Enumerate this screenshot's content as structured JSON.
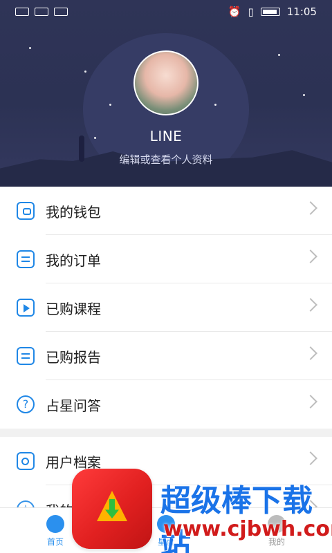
{
  "status_bar": {
    "time": "11:05",
    "left_icons": [
      "sim-icon",
      "signal-icon",
      "wifi-icon"
    ],
    "right_icons": [
      "alarm-icon",
      "vibrate-icon",
      "battery-icon"
    ]
  },
  "profile": {
    "name": "LINE",
    "subtitle": "编辑或查看个人资料",
    "avatar_icon": "avatar-image"
  },
  "menu": [
    {
      "label": "我的钱包",
      "icon": "wallet-icon"
    },
    {
      "label": "我的订单",
      "icon": "order-icon"
    },
    {
      "label": "已购课程",
      "icon": "play-icon"
    },
    {
      "label": "已购报告",
      "icon": "report-icon"
    },
    {
      "label": "占星问答",
      "icon": "question-icon"
    },
    {
      "label": "用户档案",
      "icon": "profile-icon"
    },
    {
      "label": "我的",
      "icon": "star-icon"
    }
  ],
  "tabs": [
    {
      "label": "首页",
      "icon": "home-icon",
      "active": true
    },
    {
      "label": "星盘",
      "icon": "chart-icon",
      "active": false
    },
    {
      "label": "我的",
      "icon": "user-icon",
      "active": false
    }
  ],
  "watermark": {
    "title": "超级棒下载站",
    "url": "www.cjbwh.com"
  },
  "colors": {
    "header_bg": "#2f3457",
    "accent_blue": "#1f87e6",
    "watermark_red": "#d11b1b",
    "watermark_blue": "#1a73e8"
  }
}
